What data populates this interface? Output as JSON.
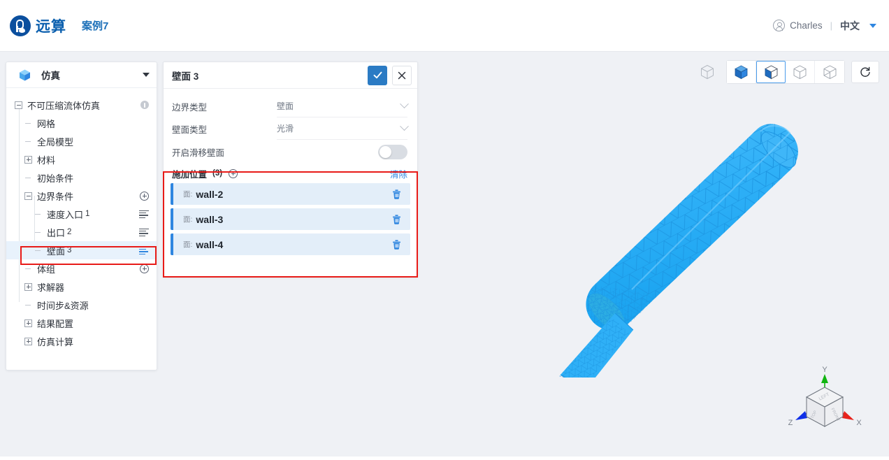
{
  "header": {
    "brand": "远算",
    "case_name": "案例7",
    "user": "Charles",
    "divider": "|",
    "language": "中文",
    "icons": {
      "logo": "yuansuan-logo",
      "user": "user-circle-icon",
      "caret": "chevron-down-icon"
    }
  },
  "sidebar": {
    "title": "仿真",
    "icon": "cube-icon",
    "tree": [
      {
        "label": "不可压缩流体仿真",
        "num": "",
        "toggle": "minus",
        "depth": 0,
        "right_icon": "info-icon",
        "selected": false
      },
      {
        "label": "网格",
        "num": "",
        "toggle": "dash",
        "depth": 1,
        "right_icon": "",
        "selected": false
      },
      {
        "label": "全局模型",
        "num": "",
        "toggle": "dash",
        "depth": 1,
        "right_icon": "",
        "selected": false
      },
      {
        "label": "材料",
        "num": "",
        "toggle": "plus",
        "depth": 1,
        "right_icon": "",
        "selected": false
      },
      {
        "label": "初始条件",
        "num": "",
        "toggle": "dash",
        "depth": 1,
        "right_icon": "",
        "selected": false
      },
      {
        "label": "边界条件",
        "num": "",
        "toggle": "minus",
        "depth": 1,
        "right_icon": "plus-icon",
        "selected": false
      },
      {
        "label": "速度入口",
        "num": "1",
        "toggle": "dash",
        "depth": 2,
        "right_icon": "list-icon",
        "selected": false
      },
      {
        "label": "出口",
        "num": "2",
        "toggle": "dash",
        "depth": 2,
        "right_icon": "list-icon",
        "selected": false
      },
      {
        "label": "壁面",
        "num": "3",
        "toggle": "dash",
        "depth": 2,
        "right_icon": "list-icon-active",
        "selected": true
      },
      {
        "label": "体组",
        "num": "",
        "toggle": "dash",
        "depth": 1,
        "right_icon": "plus-icon",
        "selected": false
      },
      {
        "label": "求解器",
        "num": "",
        "toggle": "plus",
        "depth": 1,
        "right_icon": "",
        "selected": false
      },
      {
        "label": "时间步&资源",
        "num": "",
        "toggle": "dash",
        "depth": 1,
        "right_icon": "",
        "selected": false
      },
      {
        "label": "结果配置",
        "num": "",
        "toggle": "plus",
        "depth": 1,
        "right_icon": "",
        "selected": false
      },
      {
        "label": "仿真计算",
        "num": "",
        "toggle": "plus",
        "depth": 1,
        "right_icon": "",
        "selected": false
      }
    ]
  },
  "panel": {
    "title": "壁面",
    "title_num": "3",
    "confirm_icon": "check-icon",
    "cancel_icon": "close-icon",
    "fields": [
      {
        "label": "边界类型",
        "value": "壁面",
        "control": "select"
      },
      {
        "label": "壁面类型",
        "value": "光滑",
        "control": "select"
      }
    ],
    "toggle_row": {
      "label": "开启滑移壁面",
      "state": "off"
    },
    "apply": {
      "title": "施加位置",
      "count": "(3)",
      "add_icon": "plus-circle-icon",
      "clear_label": "清除",
      "items": [
        {
          "tag": "面:",
          "name": "wall-2",
          "delete_icon": "trash-icon"
        },
        {
          "tag": "面:",
          "name": "wall-3",
          "delete_icon": "trash-icon"
        },
        {
          "tag": "面:",
          "name": "wall-4",
          "delete_icon": "trash-icon"
        }
      ]
    }
  },
  "viewport": {
    "toolbar": [
      {
        "name": "wireframe-cube-icon",
        "active": false,
        "group": "standalone"
      },
      {
        "name": "solid-cube-icon",
        "active": false,
        "group": "display-modes"
      },
      {
        "name": "solid-edges-cube-icon",
        "active": true,
        "group": "display-modes"
      },
      {
        "name": "hidden-line-cube-icon",
        "active": false,
        "group": "display-modes"
      },
      {
        "name": "transparent-cube-icon",
        "active": false,
        "group": "display-modes"
      },
      {
        "name": "reset-view-icon",
        "active": false,
        "group": "standalone"
      }
    ],
    "model": "pipe-mesh",
    "mesh_fill": "#33b1f5",
    "mesh_edge": "#1c93e0",
    "gizmo": {
      "axes": [
        {
          "label": "Y",
          "color": "#11b411"
        },
        {
          "label": "X",
          "color": "#e8231c"
        },
        {
          "label": "Z",
          "color": "#1030e8"
        }
      ],
      "faces": [
        "LEFT",
        "TOP",
        "FRONT"
      ]
    }
  },
  "annotations": {
    "highlight_color": "#e81b18",
    "boxes": [
      "sidebar-wall-row",
      "apply-position-section"
    ]
  },
  "colors": {
    "accent": "#2f86e0",
    "confirm": "#2b7bc4",
    "background": "#eff1f5",
    "panel": "#ffffff",
    "selection": "#e8f2fc"
  }
}
